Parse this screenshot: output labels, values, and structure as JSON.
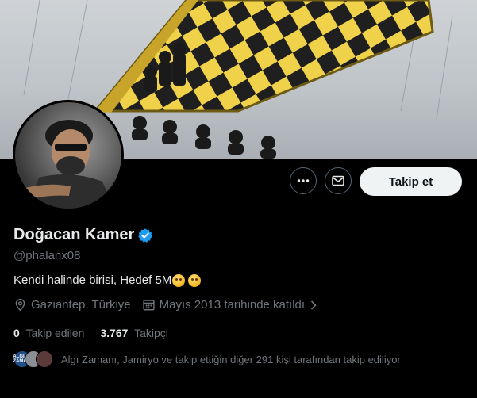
{
  "profile": {
    "name": "Doğacan Kamer",
    "handle": "@phalanx08",
    "bio": "Kendi halinde birisi, Hedef 5M",
    "location": "Gaziantep, Türkiye",
    "joined": "Mayıs 2013 tarihinde katıldı"
  },
  "actions": {
    "follow_label": "Takip et"
  },
  "stats": {
    "following_count": "0",
    "following_label": "Takip edilen",
    "followers_count": "3.767",
    "followers_label": "Takipçi"
  },
  "known_followers": {
    "text": "Algı Zamanı, Jamiryo ve takip ettiğin diğer 291 kişi tarafından takip ediliyor",
    "first_avatar_text": "ALGI ZAMANI"
  },
  "icons": {
    "more": "more-horizontal-icon",
    "message": "mail-icon",
    "verified": "verified-badge-icon",
    "location": "location-pin-icon",
    "calendar": "calendar-icon"
  },
  "colors": {
    "verified": "#1d9bf0",
    "follow_button_bg": "#eff3f4",
    "muted_text": "#71767b"
  }
}
